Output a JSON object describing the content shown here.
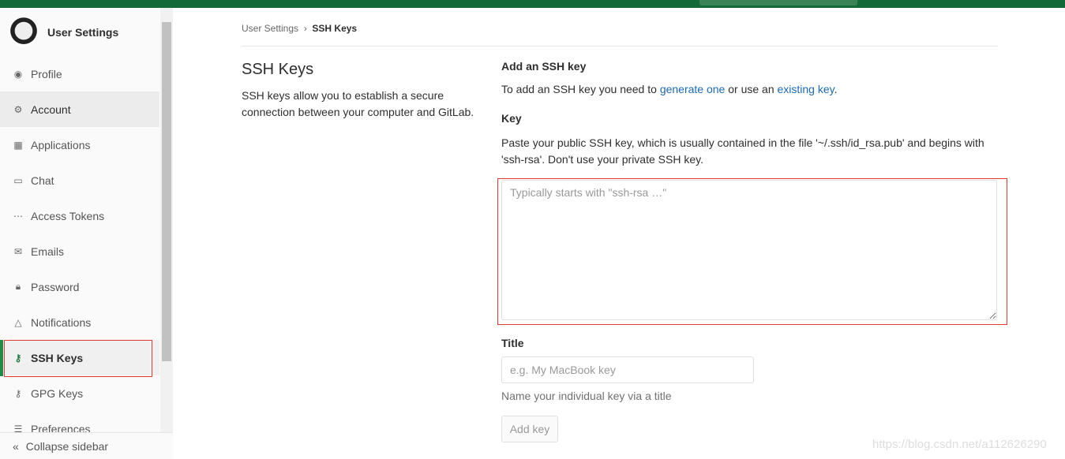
{
  "sidebar": {
    "title": "User Settings",
    "items": [
      {
        "label": "Profile",
        "icon": "profile-icon"
      },
      {
        "label": "Account",
        "icon": "account-icon"
      },
      {
        "label": "Applications",
        "icon": "applications-icon"
      },
      {
        "label": "Chat",
        "icon": "chat-icon"
      },
      {
        "label": "Access Tokens",
        "icon": "token-icon"
      },
      {
        "label": "Emails",
        "icon": "email-icon"
      },
      {
        "label": "Password",
        "icon": "lock-icon"
      },
      {
        "label": "Notifications",
        "icon": "bell-icon"
      },
      {
        "label": "SSH Keys",
        "icon": "key-icon"
      },
      {
        "label": "GPG Keys",
        "icon": "key-icon"
      },
      {
        "label": "Preferences",
        "icon": "sliders-icon"
      }
    ],
    "collapse": "Collapse sidebar",
    "active": "SSH Keys"
  },
  "breadcrumb": {
    "parent": "User Settings",
    "current": "SSH Keys"
  },
  "section": {
    "title": "SSH Keys",
    "description": "SSH keys allow you to establish a secure connection between your computer and GitLab."
  },
  "form": {
    "add_heading": "Add an SSH key",
    "intro_pre": "To add an SSH key you need to ",
    "link1": "generate one",
    "intro_mid": " or use an ",
    "link2": "existing key",
    "intro_post": ".",
    "key_label": "Key",
    "key_help": "Paste your public SSH key, which is usually contained in the file '~/.ssh/id_rsa.pub' and begins with 'ssh-rsa'. Don't use your private SSH key.",
    "key_placeholder": "Typically starts with \"ssh-rsa …\"",
    "key_value": "",
    "title_label": "Title",
    "title_placeholder": "e.g. My MacBook key",
    "title_value": "",
    "title_help": "Name your individual key via a title",
    "submit": "Add key"
  },
  "watermark": "https://blog.csdn.net/a112626290",
  "colors": {
    "header": "#136a38",
    "active": "#1f8a4a",
    "highlight": "#e53935",
    "link": "#1b69b6"
  }
}
